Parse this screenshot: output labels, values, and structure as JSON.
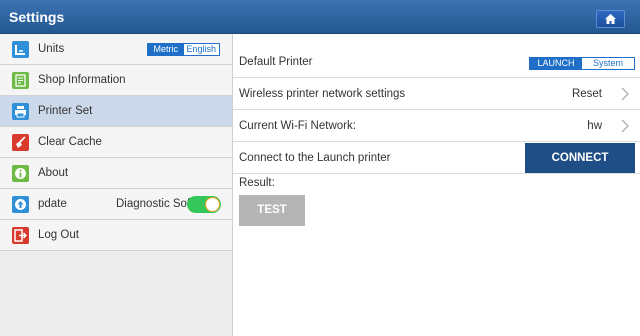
{
  "header": {
    "title": "Settings",
    "home_icon": "home-icon"
  },
  "sidebar": {
    "items": [
      {
        "label": "Units",
        "icon": "units-icon",
        "icon_color": "#2f8fd8"
      },
      {
        "label": "Shop Information",
        "icon": "shop-info-icon",
        "icon_color": "#6dbb45"
      },
      {
        "label": "Printer Set",
        "icon": "printer-icon",
        "icon_color": "#2f8fd8",
        "active": true
      },
      {
        "label": "Clear Cache",
        "icon": "broom-icon",
        "icon_color": "#d83a2e"
      },
      {
        "label": "About",
        "icon": "info-icon",
        "icon_color": "#6dbb45"
      },
      {
        "label": "pdate",
        "icon": "update-icon",
        "icon_color": "#2f8fd8"
      },
      {
        "label": "Log Out",
        "icon": "logout-icon",
        "icon_color": "#d83a2e"
      }
    ],
    "units_toggle": {
      "selected": "Metric",
      "other": "English"
    },
    "diagnostic": {
      "label": "Diagnostic Sof",
      "enabled": true
    }
  },
  "main": {
    "default_printer": {
      "label": "Default Printer",
      "selected": "LAUNCH",
      "other": "System"
    },
    "wireless": {
      "label": "Wireless printer network settings",
      "value": "Reset"
    },
    "wifi": {
      "label": "Current Wi-Fi Network:",
      "value": "hw"
    },
    "connect": {
      "label": "Connect to the Launch printer",
      "button": "CONNECT"
    },
    "result_label": "Result:",
    "test_print": "TEST PRINT"
  },
  "colors": {
    "accent": "#1f6fc9",
    "header": "#2f65a5",
    "connect": "#1f4d86",
    "switch_on": "#36c75b"
  }
}
